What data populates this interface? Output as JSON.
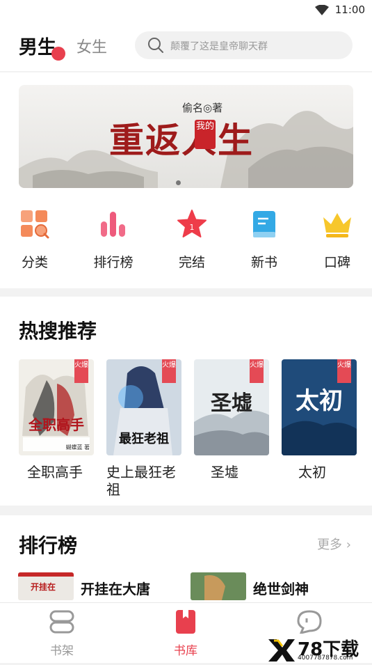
{
  "status": {
    "time": "11:00"
  },
  "header": {
    "tab_male": "男生",
    "tab_female": "女生",
    "search_placeholder": "颠覆了这是皇帝聊天群"
  },
  "banner": {
    "author": "偷名◎著",
    "title": "重返人生",
    "seal": "我的"
  },
  "categories": [
    {
      "label": "分类",
      "icon": "category-grid-icon"
    },
    {
      "label": "排行榜",
      "icon": "ranking-bars-icon"
    },
    {
      "label": "完结",
      "icon": "star-icon"
    },
    {
      "label": "新书",
      "icon": "new-book-icon"
    },
    {
      "label": "口碑",
      "icon": "crown-icon"
    }
  ],
  "hot": {
    "title": "热搜推荐",
    "books": [
      {
        "title": "全职高手",
        "tag": "火爆",
        "cover_author": "蝴蝶蓝 著"
      },
      {
        "title": "史上最狂老祖",
        "tag": "火爆",
        "cover_text": "最狂老祖"
      },
      {
        "title": "圣墟",
        "tag": "火爆"
      },
      {
        "title": "太初",
        "tag": "火爆"
      }
    ]
  },
  "ranking": {
    "title": "排行榜",
    "more": "更多",
    "items": [
      {
        "title": "开挂在大唐",
        "thumb_text": "开挂在"
      },
      {
        "title": "绝世剑神"
      }
    ]
  },
  "bottom_nav": [
    {
      "label": "书架",
      "icon": "bookshelf-icon",
      "active": false
    },
    {
      "label": "书库",
      "icon": "library-icon",
      "active": true
    },
    {
      "label": "",
      "icon": "chat-bubble-icon",
      "active": false
    }
  ],
  "watermark": {
    "text": "78下载",
    "sub": "4007787878.com"
  },
  "colors": {
    "accent": "#e8404e",
    "active_nav": "#e8404e"
  }
}
